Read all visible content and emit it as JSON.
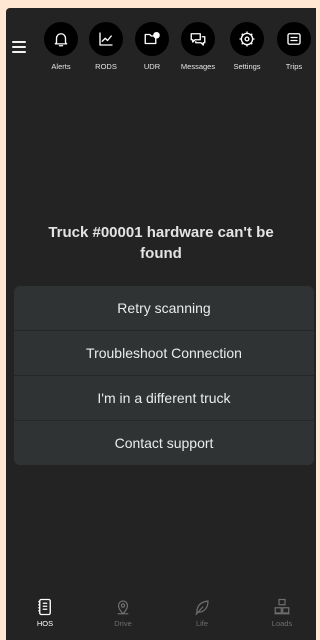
{
  "top_nav": {
    "items": [
      {
        "label": "Alerts",
        "icon": "bell-icon"
      },
      {
        "label": "RODS",
        "icon": "line-chart-icon"
      },
      {
        "label": "UDR",
        "icon": "folder-question-icon"
      },
      {
        "label": "Messages",
        "icon": "chat-bubbles-icon"
      },
      {
        "label": "Settings",
        "icon": "gear-icon"
      },
      {
        "label": "Trips",
        "icon": "document-list-icon"
      }
    ]
  },
  "message": {
    "title": "Truck #00001 hardware can't be found"
  },
  "options": [
    {
      "label": "Retry scanning"
    },
    {
      "label": "Troubleshoot Connection"
    },
    {
      "label": "I'm in a different truck"
    },
    {
      "label": "Contact support"
    }
  ],
  "tabs": [
    {
      "label": "HOS",
      "icon": "logbook-icon",
      "active": true
    },
    {
      "label": "Drive",
      "icon": "map-pin-icon",
      "active": false
    },
    {
      "label": "Life",
      "icon": "leaf-icon",
      "active": false
    },
    {
      "label": "Loads",
      "icon": "boxes-icon",
      "active": false
    }
  ],
  "colors": {
    "background": "#232323",
    "panel": "#2f3333",
    "page_backdrop": "#FFE7D4"
  }
}
